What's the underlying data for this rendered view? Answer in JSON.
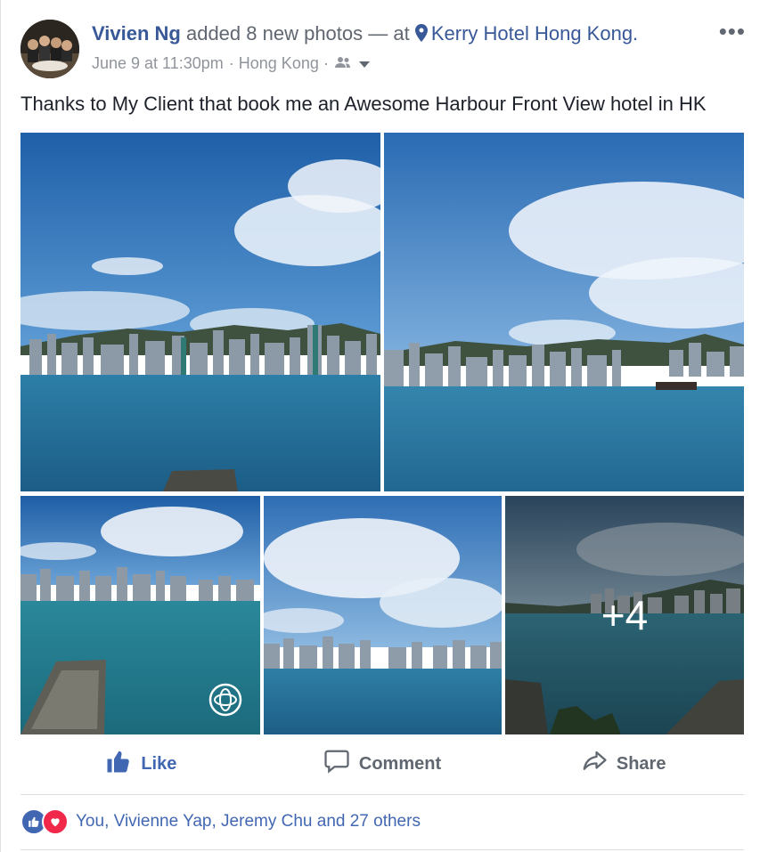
{
  "post": {
    "author": "Vivien Ng",
    "action_text": " added 8 new photos — at ",
    "location": "Kerry Hotel Hong Kong.",
    "timestamp": "June 9 at 11:30pm",
    "place": " · Hong Kong · ",
    "caption": "Thanks to My Client that book me an Awesome Harbour Front View hotel in HK",
    "more_photos_label": "+4",
    "icons": {
      "location": "map-pin-icon",
      "audience": "friends-icon",
      "menu": "more-dots-icon",
      "pano": "360-photo-icon"
    }
  },
  "actions": {
    "like": "Like",
    "comment": "Comment",
    "share": "Share"
  },
  "reactions": {
    "summary": "You, Vivienne Yap, Jeremy Chu and 27 others"
  },
  "colors": {
    "link_blue": "#385898",
    "like_blue": "#4267b2",
    "love_red": "#f0284a",
    "meta_gray": "#90949c"
  }
}
